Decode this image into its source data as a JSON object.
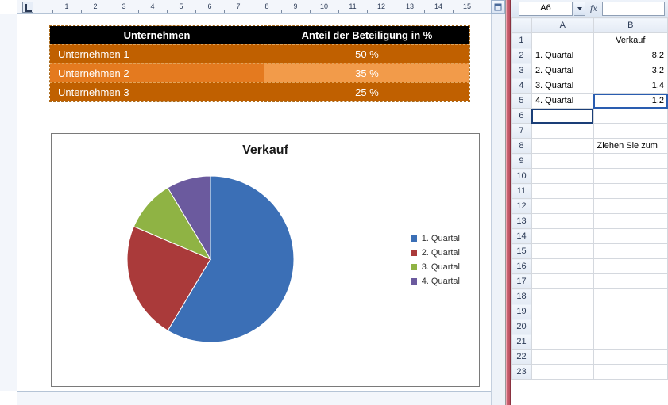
{
  "word": {
    "ruler_numbers": [
      1,
      2,
      3,
      4,
      5,
      6,
      7,
      8,
      9,
      10,
      11,
      12,
      13,
      14,
      15
    ],
    "table": {
      "headers": [
        "Unternehmen",
        "Anteil der Beteiligung in %"
      ],
      "rows": [
        {
          "name": "Unternehmen 1",
          "value": "50 %"
        },
        {
          "name": "Unternehmen 2",
          "value": "35 %"
        },
        {
          "name": "Unternehmen 3",
          "value": "25 %"
        }
      ]
    }
  },
  "chart_data": {
    "type": "pie",
    "title": "Verkauf",
    "series": [
      {
        "name": "1. Quartal",
        "value": 8.2,
        "color": "#3b6fb6"
      },
      {
        "name": "2. Quartal",
        "value": 3.2,
        "color": "#aa3a3a"
      },
      {
        "name": "3. Quartal",
        "value": 1.4,
        "color": "#8fb344"
      },
      {
        "name": "4. Quartal",
        "value": 1.2,
        "color": "#6b5a9e"
      }
    ],
    "legend_position": "right"
  },
  "excel": {
    "name_box": "A6",
    "fx_label": "fx",
    "columns": [
      "A",
      "B"
    ],
    "rows": [
      {
        "n": 1,
        "A": "",
        "B": "Verkauf",
        "B_align": "center"
      },
      {
        "n": 2,
        "A": "1. Quartal",
        "B": "8,2",
        "B_align": "right"
      },
      {
        "n": 3,
        "A": "2. Quartal",
        "B": "3,2",
        "B_align": "right"
      },
      {
        "n": 4,
        "A": "3. Quartal",
        "B": "1,4",
        "B_align": "right"
      },
      {
        "n": 5,
        "A": "4. Quartal",
        "B": "1,2",
        "B_align": "right",
        "B_boxed": true
      },
      {
        "n": 6,
        "A": "",
        "B": "",
        "selected": true
      },
      {
        "n": 7,
        "A": "",
        "B": ""
      },
      {
        "n": 8,
        "A": "",
        "B": "Ziehen Sie zum"
      },
      {
        "n": 9
      },
      {
        "n": 10
      },
      {
        "n": 11
      },
      {
        "n": 12
      },
      {
        "n": 13
      },
      {
        "n": 14
      },
      {
        "n": 15
      },
      {
        "n": 16
      },
      {
        "n": 17
      },
      {
        "n": 18
      },
      {
        "n": 19
      },
      {
        "n": 20
      },
      {
        "n": 21
      },
      {
        "n": 22
      },
      {
        "n": 23
      }
    ]
  }
}
